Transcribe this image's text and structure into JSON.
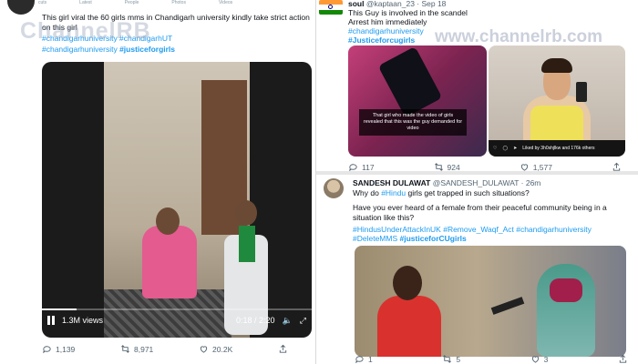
{
  "left_tweet": {
    "header_fragments": [
      "cuts",
      "Latest",
      "People",
      "Photos",
      "Videos"
    ],
    "text": "This girl viral the 60 girls mms in Chandigarh university kindly take strict action on this girl",
    "hashtags_line1": "#chandigarhuniversity #chandigarhUT",
    "hashtags_line2_a": "#chandigarhuniversity",
    "hashtags_line2_b": "#justiceforgirls",
    "watermark": "ChannelRB",
    "video": {
      "views": "1.3M views",
      "time": "0:18 / 2:20",
      "progress": 0.13
    },
    "actions": {
      "replies": "1,139",
      "retweets": "8,971",
      "likes": "20.2K"
    }
  },
  "right_top_tweet": {
    "name": "soul",
    "handle_date": "@kaptaan_23 · Sep 18",
    "line1": "This Guy is involved in the scandel",
    "line2": "Arrest him immediately",
    "hashtag1": "#chandigarhuniversity",
    "hashtag2": "#Justiceforcugirls",
    "watermark": "www.channelrb.com",
    "image_caption": "That girl who made the video of girls revealed that this was the guy demanded for video",
    "insta_caption": "Liked by 3h0shjlkw and 176k others",
    "actions": {
      "replies": "117",
      "retweets": "924",
      "likes": "1,577"
    }
  },
  "right_bottom_tweet": {
    "name": "SANDESH DULAWAT",
    "handle_date": "@SANDESH_DULAWAT · 26m",
    "line1_a": "Why do ",
    "line1_tag": "#Hindu",
    "line1_b": " girls get trapped in such situations?",
    "para2": "Have you ever heard of a female from their peaceful community being in a situation like this?",
    "tags_line1": "#HindusUnderAttackInUK #Remove_Waqf_Act #chandigarhuniversity",
    "tags_line2_a": "#DeleteMMS",
    "tags_line2_b": "#justiceforCUgirls",
    "actions": {
      "replies": "1",
      "retweets": "5",
      "likes": "3"
    }
  },
  "colors": {
    "link": "#1d9bf0",
    "text": "#0f1419",
    "muted": "#536471"
  }
}
